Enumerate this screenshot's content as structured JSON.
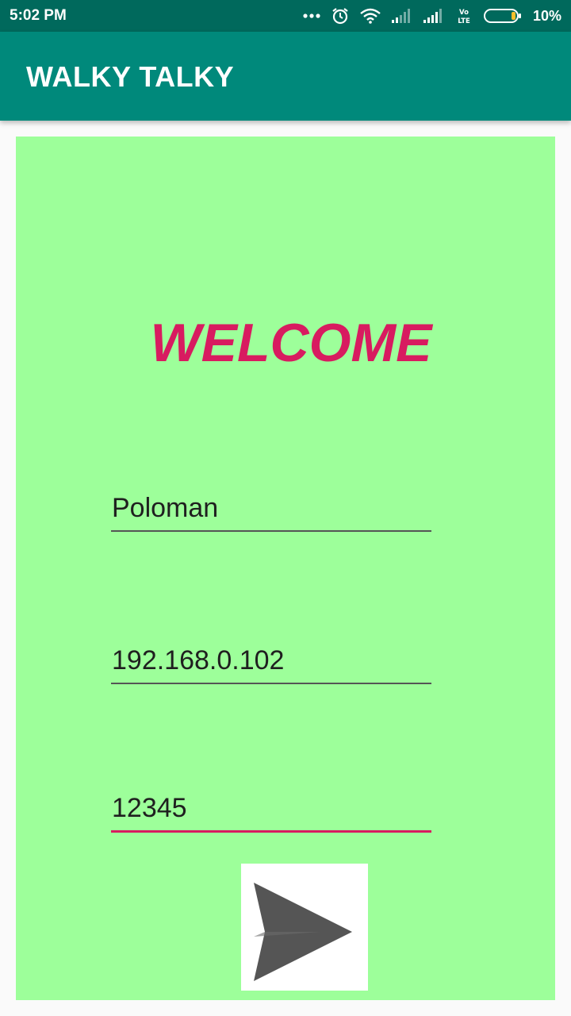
{
  "status_bar": {
    "time": "5:02 PM",
    "battery_percent": "10%",
    "battery_level": 0.1,
    "icons": [
      "more-dots-icon",
      "alarm-icon",
      "wifi-icon",
      "signal-1-icon",
      "signal-2-icon",
      "volte-icon",
      "battery-icon"
    ]
  },
  "app_bar": {
    "title": "WALKY TALKY"
  },
  "colors": {
    "status_bar": "#00695c",
    "app_bar": "#00897b",
    "panel": "#9dff9a",
    "accent": "#d81b60",
    "send_icon": "#555555"
  },
  "main": {
    "welcome": "WELCOME",
    "name_field": {
      "value": "Poloman"
    },
    "ip_field": {
      "value": "192.168.0.102"
    },
    "port_field": {
      "value": "12345"
    },
    "send_button": {
      "icon": "send-icon"
    }
  }
}
